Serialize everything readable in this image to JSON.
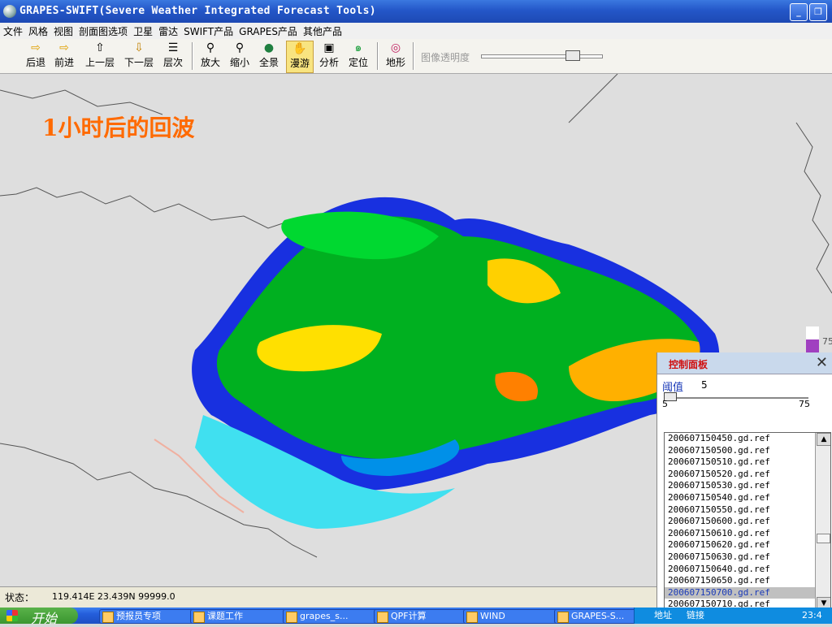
{
  "window": {
    "title": "GRAPES-SWIFT(Severe Weather Integrated Forecast Tools)",
    "min": "_",
    "max": "❐"
  },
  "menu": [
    "文件",
    "风格",
    "视图",
    "剖面图选项",
    "卫星",
    "雷达",
    "SWIFT产品",
    "GRAPES产品",
    "其他产品"
  ],
  "toolbar": {
    "buttons": [
      {
        "label": "后退",
        "icon": "⇨"
      },
      {
        "label": "前进",
        "icon": "⇨"
      },
      {
        "label": "上一层",
        "icon": "⇦"
      },
      {
        "label": "下一层",
        "icon": "⬆"
      },
      {
        "label": "层次",
        "icon": "⬇"
      },
      {
        "label": "放大",
        "icon": "☰"
      },
      {
        "label": "缩小",
        "icon": "⚲"
      },
      {
        "label": "全景",
        "icon": "⚲"
      },
      {
        "label": "漫游",
        "icon": "●"
      },
      {
        "label": "分析",
        "icon": "✋"
      },
      {
        "label": "定位",
        "icon": "▣"
      },
      {
        "label": "地形",
        "icon": "๑"
      }
    ],
    "opacity_label": "图像透明度",
    "opacity_value": 0.72
  },
  "map": {
    "caption": "1小时后的回波",
    "legend_label": "75",
    "legend_colors": [
      "#ffffff",
      "#a040c0",
      "#ff00ff",
      "#c00000",
      "#ff0000",
      "#ff9000",
      "#ffc000",
      "#ffff00",
      "#00a000",
      "#00d000",
      "#00ff00",
      "#0000f0",
      "#00a0f0",
      "#00ecec"
    ]
  },
  "panel": {
    "title": "控制面板",
    "close": "✕",
    "threshold_label": "阈值",
    "threshold_value": "5",
    "min": "5",
    "max": "75",
    "files": [
      "200607150450.gd.ref",
      "200607150500.gd.ref",
      "200607150510.gd.ref",
      "200607150520.gd.ref",
      "200607150530.gd.ref",
      "200607150540.gd.ref",
      "200607150550.gd.ref",
      "200607150600.gd.ref",
      "200607150610.gd.ref",
      "200607150620.gd.ref",
      "200607150630.gd.ref",
      "200607150640.gd.ref",
      "200607150650.gd.ref",
      "200607150700.gd.ref",
      "200607150710.gd.ref"
    ],
    "selected_index": 13
  },
  "status": {
    "label": "状态：",
    "coord": "119.414E  23.439N  99999.0"
  },
  "taskbar": {
    "start": "开始",
    "tasks": [
      "预报员专项",
      "课题工作",
      "grapes_s...",
      "QPF计算",
      "WIND",
      "GRAPES-S..."
    ],
    "tray": {
      "address": "地址",
      "links": "链接",
      "time": "23:4"
    }
  }
}
